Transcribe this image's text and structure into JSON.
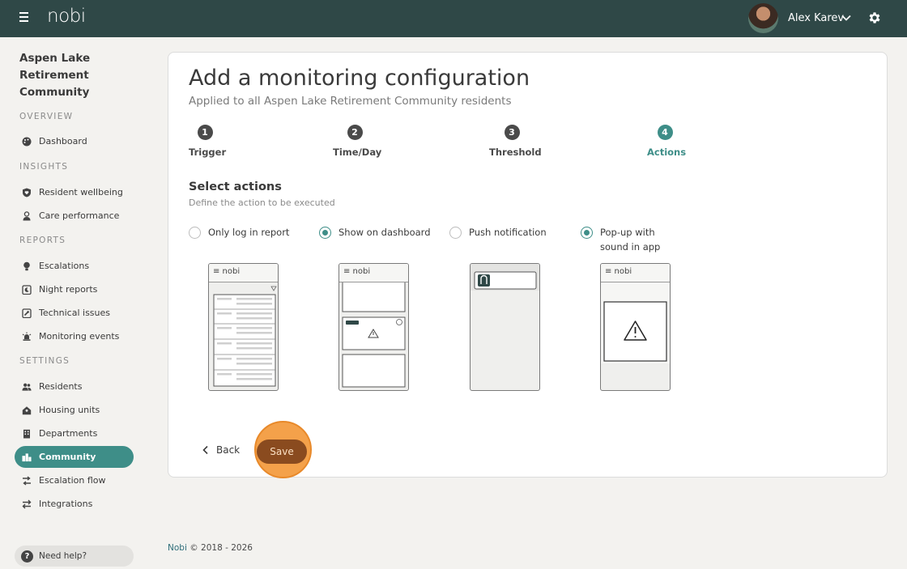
{
  "header": {
    "logo": "nobi",
    "user_name": "Alex Karev"
  },
  "sidebar": {
    "community_name": "Aspen Lake Retirement Community",
    "sections": {
      "overview": "OVERVIEW",
      "insights": "INSIGHTS",
      "reports": "REPORTS",
      "settings": "SETTINGS"
    },
    "items": {
      "dashboard": "Dashboard",
      "resident_wellbeing": "Resident wellbeing",
      "care_performance": "Care performance",
      "escalations": "Escalations",
      "night_reports": "Night reports",
      "technical_issues": "Technical issues",
      "monitoring_events": "Monitoring events",
      "residents": "Residents",
      "housing_units": "Housing units",
      "departments": "Departments",
      "community": "Community",
      "escalation_flow": "Escalation flow",
      "integrations": "Integrations"
    },
    "active_item": "community",
    "help_label": "Need help?"
  },
  "main": {
    "title": "Add a monitoring configuration",
    "subtitle": "Applied to all Aspen Lake Retirement Community residents",
    "steps": [
      {
        "number": "1",
        "label": "Trigger"
      },
      {
        "number": "2",
        "label": "Time/Day"
      },
      {
        "number": "3",
        "label": "Threshold"
      },
      {
        "number": "4",
        "label": "Actions"
      }
    ],
    "active_step": 4,
    "section_title": "Select actions",
    "section_subtitle": "Define the action to be executed",
    "options": [
      {
        "label": "Only log in report",
        "checked": false
      },
      {
        "label": "Show on dashboard",
        "checked": true
      },
      {
        "label": "Push notification",
        "checked": false
      },
      {
        "label": "Pop-up with sound in app",
        "checked": true
      }
    ],
    "preview_logo": "≡ nobi",
    "back_label": "Back",
    "save_label": "Save"
  },
  "footer": {
    "brand": "Nobi",
    "copyright": "© 2018 - 2026"
  },
  "colors": {
    "topbar": "#2f4847",
    "accent": "#3e8e88",
    "save_button": "#8a4b1f",
    "save_highlight": "#f4a14a"
  }
}
